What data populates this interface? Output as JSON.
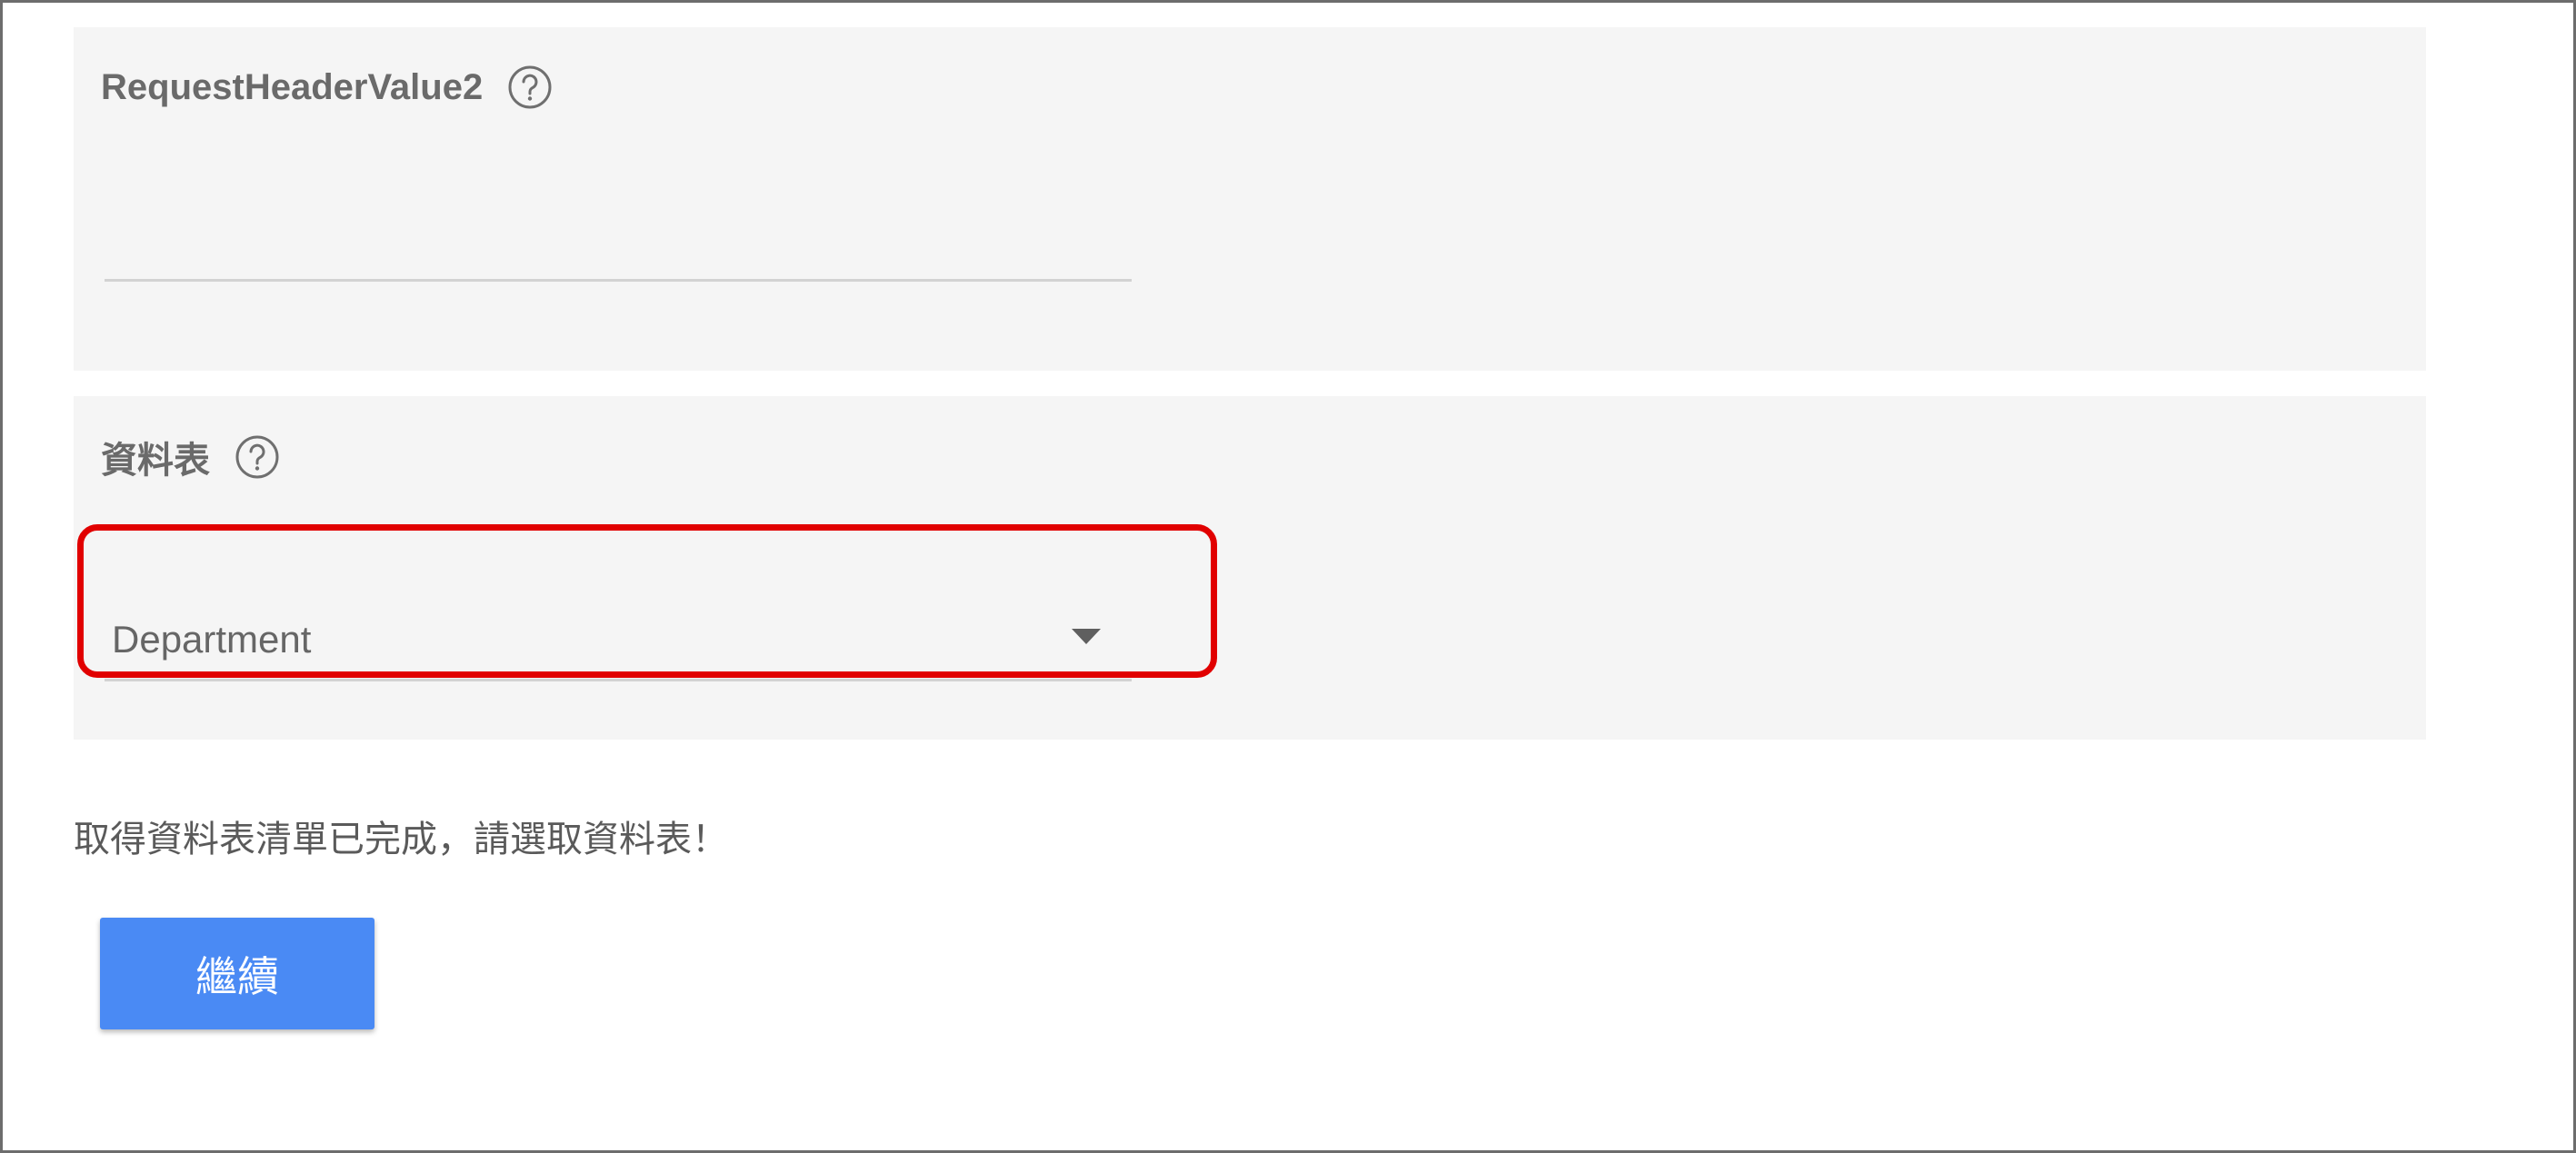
{
  "request_header_field": {
    "label": "RequestHeaderValue2",
    "value": "",
    "help_icon": "question-circle-icon"
  },
  "table_field": {
    "label": "資料表",
    "selected": "Department",
    "help_icon": "question-circle-icon",
    "dropdown_icon": "caret-down-icon"
  },
  "status_message": "取得資料表清單已完成，請選取資料表！",
  "continue_button": {
    "label": "繼續",
    "color": "#4a8af4"
  },
  "highlight_color": "#e10000"
}
